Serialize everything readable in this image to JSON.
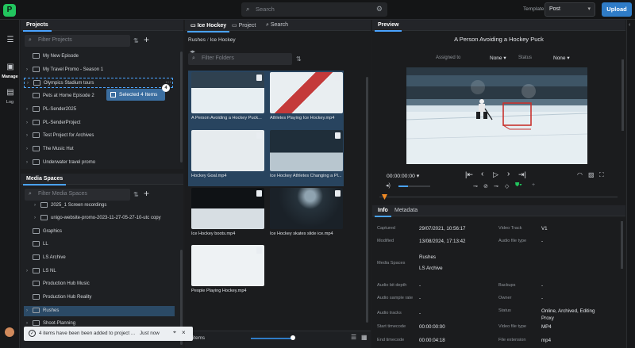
{
  "topbar": {
    "logo_letter": "P",
    "search_placeholder": "Search",
    "template_label": "Template",
    "template_value": "Post",
    "upload_label": "Upload"
  },
  "rail": {
    "manage_label": "Manage",
    "log_label": "Log"
  },
  "projects": {
    "tab": "Projects",
    "filter_placeholder": "Filter Projects",
    "items": [
      {
        "label": "My New Episode"
      },
      {
        "label": "My Travel Promo - Season 1"
      },
      {
        "label": "Olympics Stadium tours"
      },
      {
        "label": "Pets at Home Episode 2"
      },
      {
        "label": "PL-Sender2025"
      },
      {
        "label": "PL-SenderProject"
      },
      {
        "label": "Test Project for Archives"
      },
      {
        "label": "The Music Hut"
      },
      {
        "label": "Underwater travel promo"
      }
    ],
    "drag_label": "Selected 4 Items",
    "drag_count": "4"
  },
  "media_spaces": {
    "tab": "Media Spaces",
    "filter_placeholder": "Filter Media Spaces",
    "items": [
      {
        "label": "2025_1 Screen recordings"
      },
      {
        "label": "unigo-website-promo-2023-11-27-05-27-10-utc copy"
      },
      {
        "label": "Graphics"
      },
      {
        "label": "LL"
      },
      {
        "label": "LS Archive"
      },
      {
        "label": "LS NL"
      },
      {
        "label": "Production Hub Music"
      },
      {
        "label": "Production Hub Reality"
      },
      {
        "label": "Rushes"
      },
      {
        "label": "Shoot-Planning"
      }
    ]
  },
  "browser": {
    "tabs": [
      {
        "label": "Ice Hockey"
      },
      {
        "label": "Project"
      },
      {
        "label": "Search"
      }
    ],
    "crumb_root": "Rushes",
    "crumb_current": "Ice Hockey",
    "filter_placeholder": "Filter Folders",
    "items": [
      {
        "caption": "A Person Avoiding a Hockey Puck..."
      },
      {
        "caption": "Athletes Playing Ice Hockey.mp4"
      },
      {
        "caption": "Hockey Goal.mp4"
      },
      {
        "caption": "Ice Hockey Athletes Changing a Pl..."
      },
      {
        "caption": "Ice Hockey boots.mp4"
      },
      {
        "caption": "Ice Hockey skates slide ice.mp4"
      },
      {
        "caption": "People Playing Hockey.mp4"
      }
    ],
    "footer_label": "items"
  },
  "preview": {
    "tab": "Preview",
    "title": "A Person Avoiding a Hockey Puck",
    "assigned_label": "Assigned to",
    "assigned_value": "None",
    "status_label": "Status",
    "status_value": "None",
    "timecode": "00:00:00:00",
    "progress": 0.02
  },
  "info": {
    "tabs": [
      {
        "label": "Info"
      },
      {
        "label": "Metadata"
      }
    ],
    "left": [
      {
        "label": "Captured",
        "value": "29/07/2021, 10:56:17"
      },
      {
        "label": "Modified",
        "value": "13/08/2024, 17:13:42"
      },
      {
        "label": "Media Spaces",
        "value": "Rushes"
      },
      {
        "label": "",
        "value": "LS Archive"
      },
      {
        "label": "Audio bit depth",
        "value": "-"
      },
      {
        "label": "Audio sample rate",
        "value": "-"
      },
      {
        "label": "Audio tracks",
        "value": "-"
      },
      {
        "label": "Start timecode",
        "value": "00:00:00:00"
      },
      {
        "label": "End timecode",
        "value": "00:00:04:18"
      }
    ],
    "right": [
      {
        "label": "Video Track",
        "value": "V1"
      },
      {
        "label": "Audio file type",
        "value": "-"
      },
      {
        "label": "Backups",
        "value": "-"
      },
      {
        "label": "Owner",
        "value": "-"
      },
      {
        "label": "Status",
        "value": "Online, Archived, Editing"
      },
      {
        "label": "",
        "value": "Proxy"
      },
      {
        "label": "Video file type",
        "value": "MP4"
      },
      {
        "label": "File extension",
        "value": "mp4"
      }
    ]
  },
  "toast": {
    "message": "4 items have been been added to project ...",
    "time": "Just now"
  },
  "colors": {
    "accent": "#2f7cc7",
    "brand": "#22c55e",
    "selection": "#2b4a66"
  }
}
